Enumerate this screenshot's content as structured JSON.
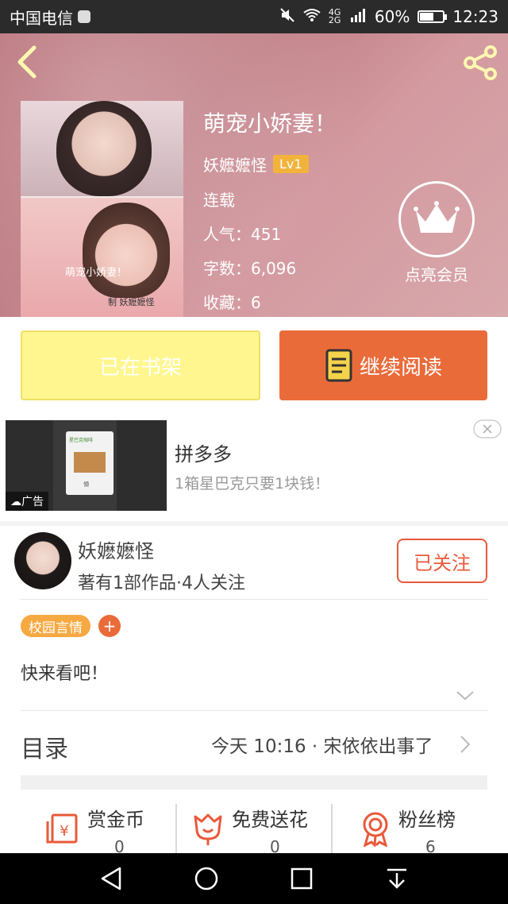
{
  "status_bar": {
    "carrier": "中国电信",
    "network": "4G 2G",
    "battery": "60%",
    "battery_level": 0.6,
    "time": "12:23"
  },
  "header": {
    "back_icon": "chevron-left-icon",
    "share_icon": "share-icon"
  },
  "book": {
    "cover_title": "萌宠小娇妻！",
    "cover_author": "制 妖嬷嬷怪",
    "title": "萌宠小娇妻！",
    "author": "妖嬷嬷怪",
    "level": "Lv1",
    "status": "连载",
    "popularity": "人气：451",
    "word_count": "字数：6,096",
    "favorites": "收藏：6"
  },
  "vip": {
    "icon": "crown-icon",
    "label": "点亮会员"
  },
  "actions": {
    "shelf_label": "已在书架",
    "read_label": "继续阅读",
    "read_icon": "book-icon"
  },
  "ad": {
    "title": "拼多多",
    "description": "1箱星巴克只要1块钱！",
    "tag": "广告",
    "card_title": "星巴克咖啡",
    "card_caption": "领"
  },
  "author_card": {
    "name": "妖嬷嬷怪",
    "stats": "著有1部作品·4人关注",
    "follow_label": "已关注"
  },
  "tags": {
    "items": [
      "校园言情"
    ],
    "add_label": "+"
  },
  "intro": {
    "text": "快来看吧！"
  },
  "toc": {
    "label": "目录",
    "latest": "今天 10:16 · 宋依依出事了"
  },
  "stats_bar": [
    {
      "label": "赏金币",
      "value": "0",
      "icon": "red-envelope-icon"
    },
    {
      "label": "免费送花",
      "value": "0",
      "icon": "flower-icon"
    },
    {
      "label": "粉丝榜",
      "value": "6",
      "icon": "medal-icon"
    }
  ],
  "colors": {
    "accent": "#ea6b3a",
    "shelf_button": "#fff68f",
    "tag": "#f6a941",
    "level_badge": "#f2b33d"
  }
}
